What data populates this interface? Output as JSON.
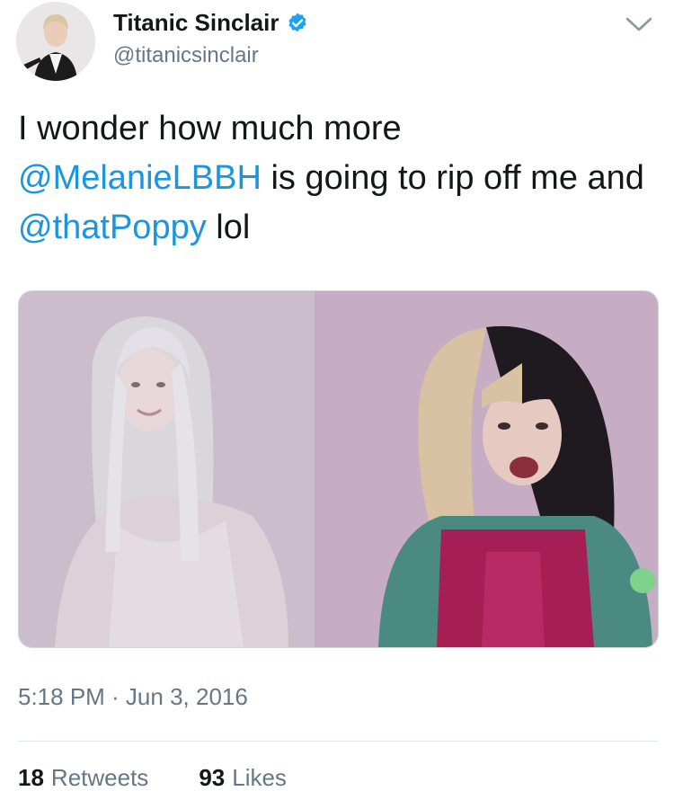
{
  "author": {
    "display_name": "Titanic Sinclair",
    "handle": "@titanicsinclair",
    "verified_icon": "verified-badge-icon",
    "verified_color": "#1da1f2"
  },
  "tweet": {
    "text_parts": {
      "t1": "I wonder how much more ",
      "m1": "@MelanieLBBH",
      "t2": " is going to rip off me and ",
      "m2": "@thatPoppy",
      "t3": " lol"
    },
    "mention_color": "#1b95e0",
    "timestamp": "5:18 PM · Jun 3, 2016"
  },
  "stats": {
    "retweets_count": "18",
    "retweets_label": "Retweets",
    "likes_count": "93",
    "likes_label": "Likes"
  },
  "icons": {
    "caret": "chevron-down-icon"
  }
}
